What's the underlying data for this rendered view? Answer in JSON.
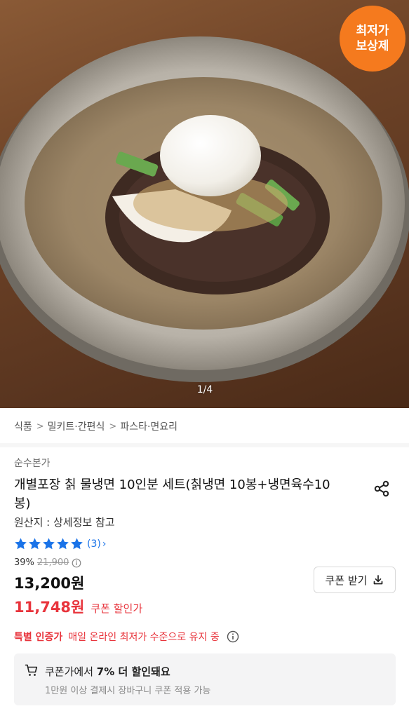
{
  "hero": {
    "badge_line1": "최저가",
    "badge_line2": "보상제",
    "image_counter": "1/4",
    "badge_color": "#f57a1e"
  },
  "breadcrumb": [
    "식품",
    "밀키트·간편식",
    "파스타·면요리"
  ],
  "product": {
    "brand": "순수본가",
    "title": "개별포장 칡 물냉면 10인분 세트(칡냉면 10봉+냉면육수10봉)",
    "origin": "원산지 : 상세정보 참고",
    "rating": 5,
    "review_count": "(3)",
    "discount_rate": "39%",
    "original_price": "21,900",
    "sale_price": "13,200원",
    "coupon_price": "11,748원",
    "coupon_price_label": "쿠폰 할인가",
    "coupon_button": "쿠폰 받기"
  },
  "special": {
    "label": "특별 인증가",
    "description": "매일 온라인 최저가 수준으로 유지 중"
  },
  "coupon_box": {
    "title_prefix": "쿠폰가에서 ",
    "title_bold": "7% 더 할인돼요",
    "subtitle": "1만원 이상 결제시 장바구니 쿠폰 적용 가능"
  },
  "colors": {
    "accent_red": "#e8343c",
    "star_blue": "#1a73e8"
  },
  "icons": [
    "share-icon",
    "star-icon",
    "chevron-right-icon",
    "info-icon",
    "download-icon",
    "cart-icon"
  ]
}
